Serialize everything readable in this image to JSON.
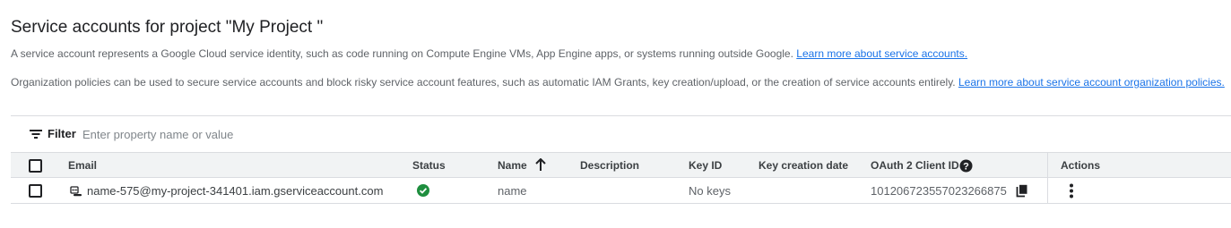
{
  "header": {
    "title": "Service accounts for project \"My Project \"",
    "description1": "A service account represents a Google Cloud service identity, such as code running on Compute Engine VMs, App Engine apps, or systems running outside Google.",
    "link1": "Learn more about service accounts.",
    "description2": "Organization policies can be used to secure service accounts and block risky service account features, such as automatic IAM Grants, key creation/upload, or the creation of service accounts entirely.",
    "link2": "Learn more about service account organization policies."
  },
  "filter": {
    "label": "Filter",
    "placeholder": "Enter property name or value"
  },
  "table": {
    "columns": {
      "email": "Email",
      "status": "Status",
      "name": "Name",
      "description": "Description",
      "key_id": "Key ID",
      "key_creation_date": "Key creation date",
      "oauth_client_id": "OAuth 2 Client ID",
      "actions": "Actions"
    },
    "rows": [
      {
        "email": "name-575@my-project-341401.iam.gserviceaccount.com",
        "status": "enabled",
        "name": "name",
        "description": "",
        "key_id": "No keys",
        "key_creation_date": "",
        "oauth_client_id": "101206723557023266875"
      }
    ]
  },
  "colors": {
    "accent": "#1a73e8",
    "status_green": "#1e8e3e",
    "header_bg": "#f1f3f4",
    "border": "#dadce0"
  },
  "icons": {
    "filter": "filter-list-icon",
    "sort": "arrow-upward-icon",
    "help": "help-circle-icon",
    "service_account": "service-account-icon",
    "status": "check-circle-icon",
    "copy": "copy-icon",
    "actions": "more-vert-icon"
  }
}
